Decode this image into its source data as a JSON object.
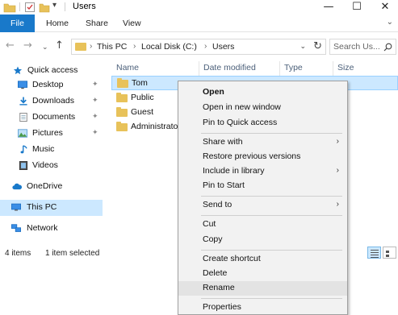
{
  "title_bar": {
    "title": "Users",
    "qat_dropdown": "▾",
    "minimize": "—",
    "maximize": "☐",
    "close": "✕"
  },
  "ribbon": {
    "tabs": [
      "File",
      "Home",
      "Share",
      "View"
    ],
    "expand": "⌄"
  },
  "navigation": {
    "back": "←",
    "forward": "→",
    "recent": "⌄",
    "up": "↑"
  },
  "address": {
    "crumbs": [
      "This PC",
      "Local Disk (C:)",
      "Users"
    ],
    "separator": "›",
    "dropdown": "⌄",
    "refresh": "↻"
  },
  "search": {
    "placeholder": "Search Us...",
    "icon": "⌕"
  },
  "nav_pane": {
    "items": [
      {
        "label": "Quick access",
        "icon": "star-icon"
      },
      {
        "label": "Desktop",
        "icon": "desktop-icon",
        "pinned": true
      },
      {
        "label": "Downloads",
        "icon": "downloads-icon",
        "pinned": true
      },
      {
        "label": "Documents",
        "icon": "documents-icon",
        "pinned": true
      },
      {
        "label": "Pictures",
        "icon": "pictures-icon",
        "pinned": true
      },
      {
        "label": "Music",
        "icon": "music-icon"
      },
      {
        "label": "Videos",
        "icon": "videos-icon"
      },
      {
        "label": "OneDrive",
        "icon": "cloud-icon"
      },
      {
        "label": "This PC",
        "icon": "computer-icon",
        "selected": true
      },
      {
        "label": "Network",
        "icon": "network-icon"
      }
    ],
    "pin_glyph": "✦"
  },
  "columns": [
    "Name",
    "Date modified",
    "Type",
    "Size"
  ],
  "files": [
    {
      "name": "Tom",
      "selected": true
    },
    {
      "name": "Public"
    },
    {
      "name": "Guest"
    },
    {
      "name": "Administrator"
    }
  ],
  "status": {
    "count": "4 items",
    "selection": "1 item selected"
  },
  "context_menu": {
    "groups": [
      [
        {
          "label": "Open",
          "bold": true
        },
        {
          "label": "Open in new window"
        },
        {
          "label": "Pin to Quick access"
        }
      ],
      [
        {
          "label": "Share with",
          "submenu": true
        },
        {
          "label": "Restore previous versions"
        },
        {
          "label": "Include in library",
          "submenu": true
        },
        {
          "label": "Pin to Start"
        }
      ],
      [
        {
          "label": "Send to",
          "submenu": true
        }
      ],
      [
        {
          "label": "Cut"
        },
        {
          "label": "Copy"
        }
      ],
      [
        {
          "label": "Create shortcut"
        },
        {
          "label": "Delete"
        },
        {
          "label": "Rename",
          "hover": true
        }
      ],
      [
        {
          "label": "Properties"
        }
      ]
    ],
    "submenu_arrow": "›"
  },
  "colors": {
    "accent": "#1979ca",
    "selection": "#cce8ff",
    "folder": "#e8c25a",
    "menu_bg": "#f2f2f2"
  }
}
